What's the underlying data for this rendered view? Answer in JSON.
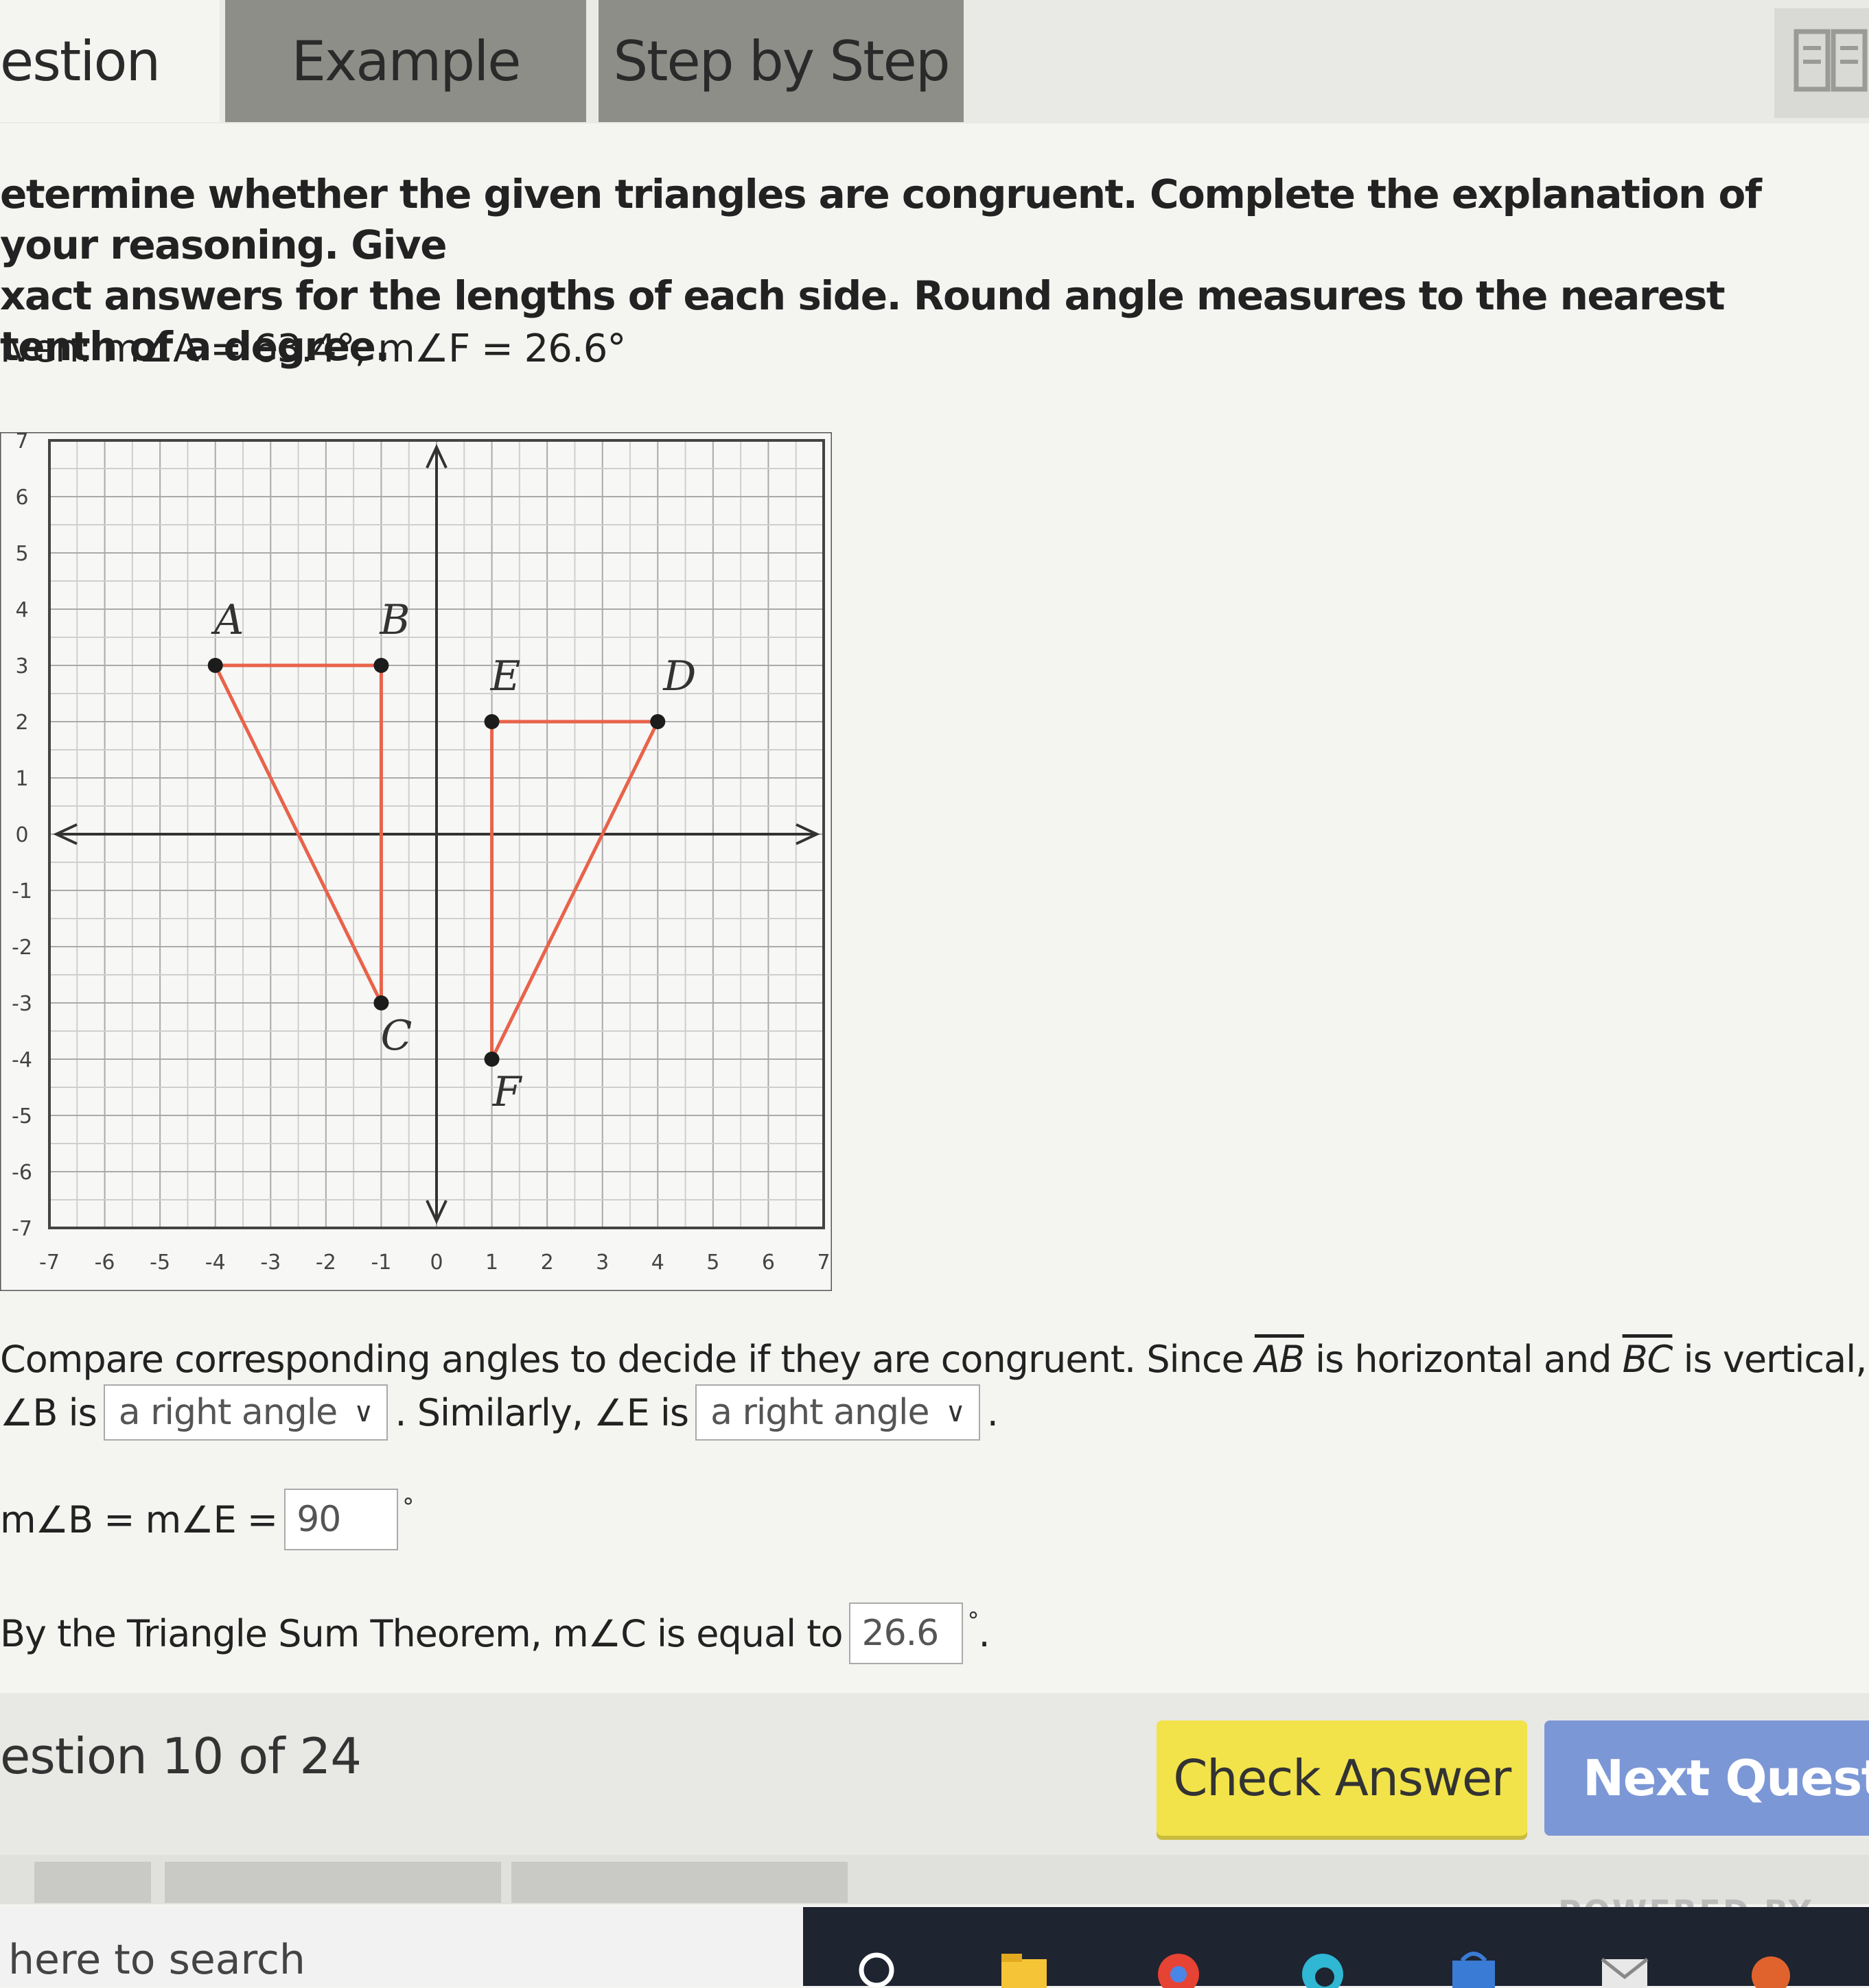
{
  "tabs": {
    "question": "estion",
    "example": "Example",
    "step_by_step": "Step by Step"
  },
  "instructions": {
    "line1": "etermine whether the given triangles are congruent. Complete the explanation of your reasoning. Give",
    "line2": "xact answers for the lengths of each side. Round angle measures to the nearest tenth of a degree."
  },
  "given": "iven: m∠A = 63.4°, m∠F = 26.6°",
  "chart_data": {
    "type": "scatter",
    "title": "",
    "xlim": [
      -7,
      7
    ],
    "ylim": [
      -7,
      7
    ],
    "grid": true,
    "x_ticks": [
      "-7",
      "-6",
      "-5",
      "-4",
      "-3",
      "-2",
      "-1",
      "0",
      "1",
      "2",
      "3",
      "4",
      "5",
      "6",
      "7"
    ],
    "y_ticks": [
      "7",
      "6",
      "5",
      "4",
      "3",
      "2",
      "1",
      "0",
      "-1",
      "-2",
      "-3",
      "-4",
      "-5",
      "-6",
      "-7"
    ],
    "points": [
      {
        "label": "A",
        "x": -4,
        "y": 3
      },
      {
        "label": "B",
        "x": -1,
        "y": 3
      },
      {
        "label": "C",
        "x": -1,
        "y": -3
      },
      {
        "label": "E",
        "x": 1,
        "y": 2
      },
      {
        "label": "D",
        "x": 4,
        "y": 2
      },
      {
        "label": "F",
        "x": 1,
        "y": -4
      }
    ],
    "triangles": [
      [
        "A",
        "B",
        "C"
      ],
      [
        "E",
        "D",
        "F"
      ]
    ],
    "line_color": "#e8634a",
    "point_color": "#1c1c1c"
  },
  "explanation": {
    "p1_a": "Compare corresponding angles to decide if they are congruent. Since ",
    "p1_ab": "AB",
    "p1_b": " is horizontal and ",
    "p1_bc": "BC",
    "p1_c": " is vertical,",
    "p2_a": "∠B is",
    "select1": "a right angle",
    "p2_b": ". Similarly, ∠E is",
    "select2": "a right angle",
    "p2_c": ".",
    "p3_a": "m∠B = m∠E =",
    "input1": "90",
    "p4_a": "By the Triangle Sum Theorem, m∠C is equal to",
    "input2": "26.6",
    "degree": "°",
    "period": "."
  },
  "footer": {
    "counter": "estion 10 of 24",
    "check": "Check Answer",
    "next": "Next Questio",
    "powered": "POWERED BY"
  },
  "taskbar": {
    "search": "here to search"
  }
}
